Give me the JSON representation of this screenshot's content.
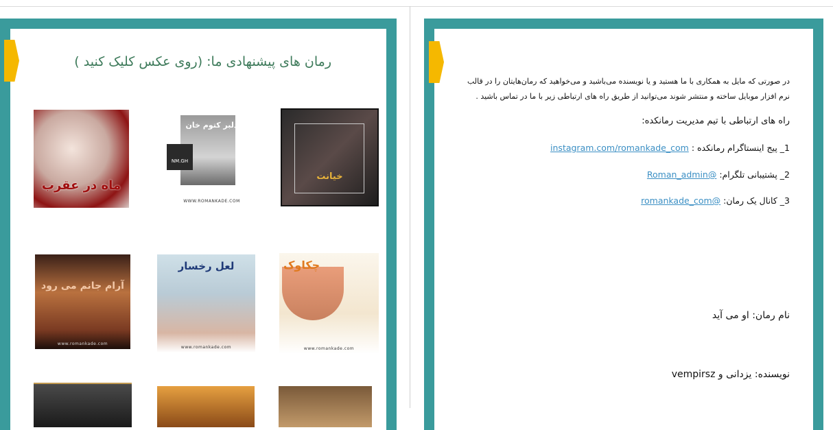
{
  "left_page": {
    "title": "رمان های پیشنهادی ما: (روی عکس کلیک کنید )",
    "covers": [
      {
        "label": "خیانت",
        "site": ""
      },
      {
        "label": "دلبر کتوم خان",
        "site": "WWW.ROMANKADE.COM",
        "badge": "NM.GH"
      },
      {
        "label": "ماه در عقرب",
        "site": ""
      },
      {
        "label": "چکاوک",
        "site": "www.romankade.com"
      },
      {
        "label": "لعل رخسار",
        "site": "www.romankade.com"
      },
      {
        "label": "آرام جانم می رود",
        "site": "www.romankade.com"
      },
      {
        "label": "",
        "site": ""
      },
      {
        "label": "",
        "site": ""
      },
      {
        "label": "",
        "site": ""
      }
    ]
  },
  "right_page": {
    "intro": "در صورتی که مایل به همکاری با ما هستید و یا نویسنده می‌باشید و می‌خواهید که رمان‌هایتان را در قالب نرم افزار موبایل ساخته و منتشر شوند می‌توانید از طریق راه های ارتباطی زیر با ما در تماس باشید .",
    "contact_title": "راه های ارتباطی با تیم مدیریت رمانکده:",
    "contacts": [
      {
        "label": "1_ پیج اینستاگرام رمانکده :",
        "link": "instagram.com/romankade_com"
      },
      {
        "label": "2_ پشتیبانی تلگرام:",
        "link": "Roman_admin@"
      },
      {
        "label": "3_ کانال یک رمان:",
        "link": "romankade_com@"
      }
    ],
    "novel_name": "نام رمان: او می آید",
    "author": "نویسنده: یزدانی و vempirsz"
  },
  "colors": {
    "frame": "#3a9b9c",
    "marker": "#f5b800",
    "title": "#3d7a5a",
    "link": "#3b8fc4"
  }
}
